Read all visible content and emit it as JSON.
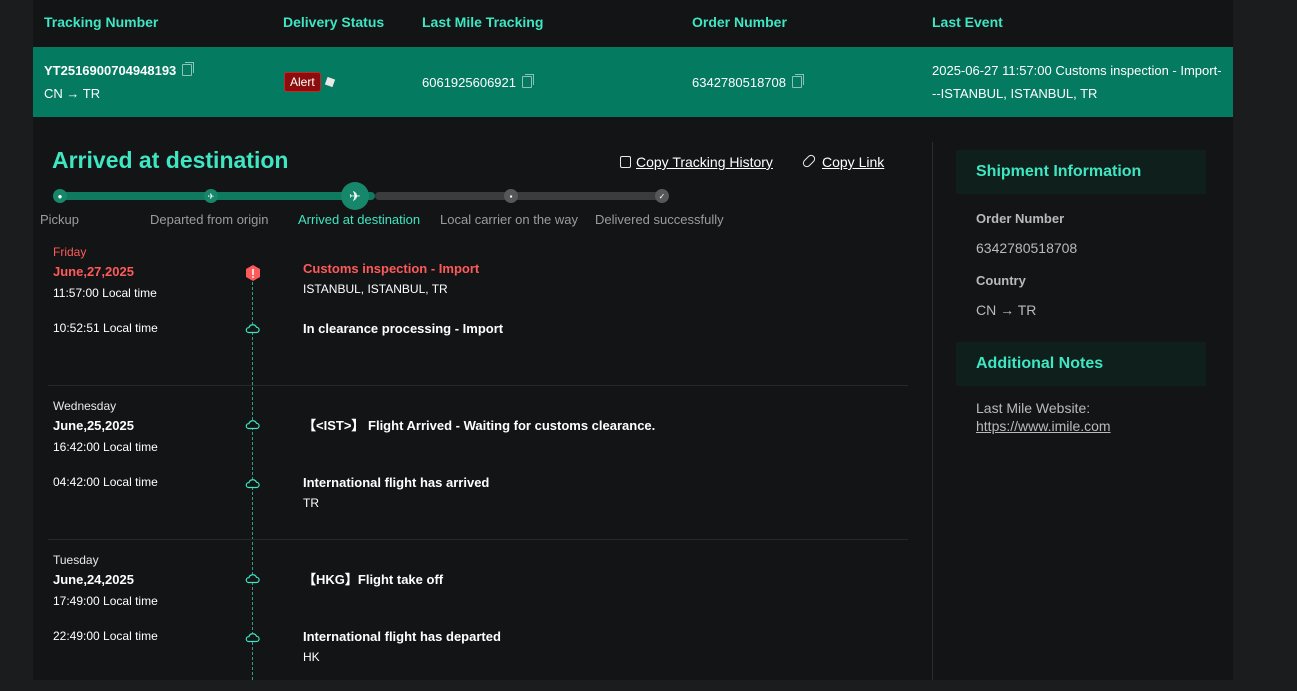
{
  "table": {
    "headers": {
      "tracking_number": "Tracking Number",
      "delivery_status": "Delivery Status",
      "last_mile_tracking": "Last Mile Tracking",
      "order_number": "Order Number",
      "last_event": "Last Event"
    },
    "row": {
      "tracking_number": "YT2516900704948193",
      "route": "CN → TR",
      "status_badge": "Alert",
      "last_mile": "6061925606921",
      "order_number": "6342780518708",
      "last_event_line1": "2025-06-27 11:57:00 Customs inspection - Import-",
      "last_event_line2": "--ISTANBUL, ISTANBUL, TR"
    }
  },
  "detail": {
    "title": "Arrived at destination",
    "copy_history": "Copy Tracking History",
    "copy_link": "Copy Link",
    "steps": [
      "Pickup",
      "Departed from origin",
      "Arrived at destination",
      "Local carrier on the way",
      "Delivered successfully"
    ]
  },
  "timeline": {
    "day1": {
      "weekday": "Friday",
      "date": "June,27,2025"
    },
    "day2": {
      "weekday": "Wednesday",
      "date": "June,25,2025"
    },
    "day3": {
      "weekday": "Tuesday",
      "date": "June,24,2025"
    },
    "events": [
      {
        "time": "11:57:00 Local time",
        "title": "Customs inspection - Import",
        "location": "ISTANBUL, ISTANBUL, TR"
      },
      {
        "time": "10:52:51 Local time",
        "title": "In clearance processing - Import",
        "location": ""
      },
      {
        "time": "16:42:00 Local time",
        "title": "【<IST>】 Flight Arrived - Waiting for customs clearance.",
        "location": ""
      },
      {
        "time": "04:42:00 Local time",
        "title": "International flight has arrived",
        "location": "TR"
      },
      {
        "time": "17:49:00 Local time",
        "title": "【HKG】Flight take off",
        "location": ""
      },
      {
        "time": "22:49:00 Local time",
        "title": "International flight has departed",
        "location": "HK"
      }
    ]
  },
  "sidebar": {
    "shipment_title": "Shipment Information",
    "order_label": "Order Number",
    "order_value": "6342780518708",
    "country_label": "Country",
    "country_value": "CN → TR",
    "notes_title": "Additional Notes",
    "notes_text": "Last Mile Website:",
    "notes_link": "https://www.imile.com"
  },
  "colors": {
    "accent": "#3ee6c2",
    "row_bg": "#047a61",
    "alert": "#ff5a5a",
    "panel": "#121416"
  }
}
